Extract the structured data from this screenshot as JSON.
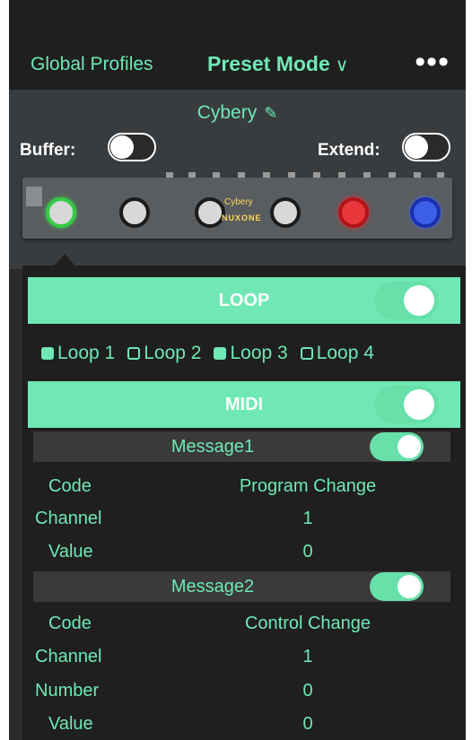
{
  "nav": {
    "global_profiles": "Global Profiles",
    "mode": "Preset Mode",
    "mode_chevron": "∨",
    "more": "•••"
  },
  "preset": {
    "name": "Cybery",
    "pencil": "✎"
  },
  "controls": {
    "buffer_label": "Buffer:",
    "extend_label": "Extend:",
    "buffer_on": false,
    "extend_on": false
  },
  "pedal": {
    "brand": "NUXONE",
    "model": "Cybery"
  },
  "loop_section": {
    "title": "LOOP",
    "enabled": true,
    "loops": [
      {
        "label": "Loop 1",
        "checked": true
      },
      {
        "label": "Loop 2",
        "checked": false
      },
      {
        "label": "Loop 3",
        "checked": true
      },
      {
        "label": "Loop 4",
        "checked": false
      }
    ]
  },
  "midi_section": {
    "title": "MIDI",
    "enabled": true,
    "messages": [
      {
        "title": "Message1",
        "enabled": true,
        "rows": [
          {
            "label": "Code",
            "value": "Program Change"
          },
          {
            "label": "Channel",
            "value": "1"
          },
          {
            "label": "Value",
            "value": "0"
          }
        ]
      },
      {
        "title": "Message2",
        "enabled": true,
        "rows": [
          {
            "label": "Code",
            "value": "Control Change"
          },
          {
            "label": "Channel",
            "value": "1"
          },
          {
            "label": "Number",
            "value": "0"
          },
          {
            "label": "Value",
            "value": "0"
          }
        ]
      }
    ]
  },
  "colors": {
    "accent": "#6fe8b6",
    "background": "#2a2a2a",
    "panel": "#393c3f"
  }
}
